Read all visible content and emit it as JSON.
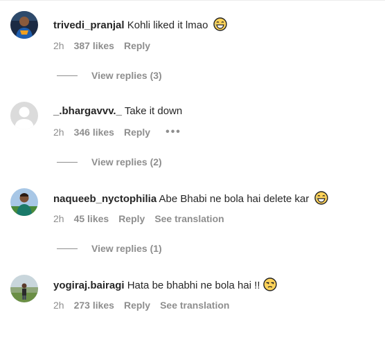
{
  "comments": [
    {
      "username": "trivedi_pranjal",
      "text": "Kohli liked it lmao",
      "emoji": "laughing-emoji",
      "time": "2h",
      "likes": "387 likes",
      "reply": "Reply",
      "view_replies": "View replies (3)"
    },
    {
      "username": "_.bhargavvv._",
      "text": "Take it down",
      "time": "2h",
      "likes": "346 likes",
      "reply": "Reply",
      "more": "•••",
      "view_replies": "View replies (2)"
    },
    {
      "username": "naqueeb_nyctophilia",
      "text": "Abe Bhabi ne bola hai delete kar",
      "emoji": "laughing-emoji",
      "time": "2h",
      "likes": "45 likes",
      "reply": "Reply",
      "translation": "See translation",
      "view_replies": "View replies (1)"
    },
    {
      "username": "yogiraj.bairagi",
      "text": "Hata be bhabhi ne bola hai !!",
      "emoji": "unamused-emoji",
      "time": "2h",
      "likes": "273 likes",
      "reply": "Reply",
      "translation": "See translation"
    }
  ]
}
